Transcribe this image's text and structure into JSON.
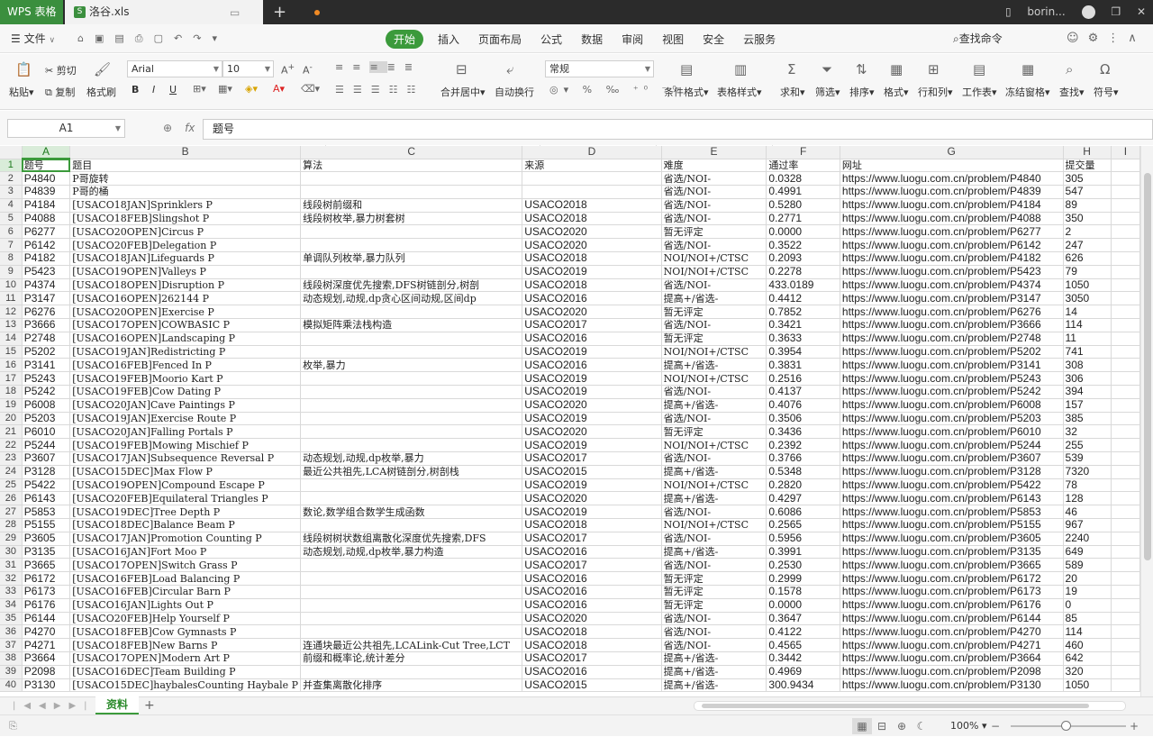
{
  "titlebar": {
    "app_tab": "WPS 表格",
    "file_tab": "洛谷.xls",
    "file_icon": "S",
    "user": "borin..."
  },
  "menubar": {
    "file_menu": "文件",
    "tabs": [
      "开始",
      "插入",
      "页面布局",
      "公式",
      "数据",
      "审阅",
      "视图",
      "安全",
      "云服务"
    ],
    "active_tab": "开始",
    "search_command": "查找命令"
  },
  "ribbon": {
    "paste": "粘贴",
    "cut": "剪切",
    "copy": "复制",
    "format_painter": "格式刷",
    "font_name": "Arial",
    "font_size": "10",
    "merge_center": "合并居中",
    "wrap_text": "自动换行",
    "number_format": "常规",
    "conditional_format": "条件格式",
    "table_style": "表格样式",
    "sum": "求和",
    "filter": "筛选",
    "sort": "排序",
    "format": "格式",
    "rows_cols": "行和列",
    "worksheet": "工作表",
    "freeze_panes": "冻结窗格",
    "find": "查找",
    "symbol": "符号"
  },
  "formula_bar": {
    "cell_ref": "A1",
    "fx": "fx",
    "content": "题号"
  },
  "sheet": {
    "column_letters": [
      "A",
      "B",
      "C",
      "D",
      "E",
      "F",
      "G",
      "H",
      "I"
    ],
    "header": [
      "题号",
      "题目",
      "算法",
      "来源",
      "难度",
      "通过率",
      "网址",
      "提交量"
    ],
    "rows": [
      [
        "P4840",
        "P哥旋转",
        "",
        "",
        "省选/NOI-",
        "0.0328",
        "https://www.luogu.com.cn/problem/P4840",
        "305"
      ],
      [
        "P4839",
        "P哥的桶",
        "",
        "",
        "省选/NOI-",
        "0.4991",
        "https://www.luogu.com.cn/problem/P4839",
        "547"
      ],
      [
        "P4184",
        "[USACO18JAN]Sprinklers P",
        "线段树前缀和",
        "USACO2018",
        "省选/NOI-",
        "0.5280",
        "https://www.luogu.com.cn/problem/P4184",
        "89"
      ],
      [
        "P4088",
        "[USACO18FEB]Slingshot P",
        "线段树枚举,暴力树套树",
        "USACO2018",
        "省选/NOI-",
        "0.2771",
        "https://www.luogu.com.cn/problem/P4088",
        "350"
      ],
      [
        "P6277",
        "[USACO20OPEN]Circus P",
        "",
        "USACO2020",
        "暂无评定",
        "0.0000",
        "https://www.luogu.com.cn/problem/P6277",
        "2"
      ],
      [
        "P6142",
        "[USACO20FEB]Delegation P",
        "",
        "USACO2020",
        "省选/NOI-",
        "0.3522",
        "https://www.luogu.com.cn/problem/P6142",
        "247"
      ],
      [
        "P4182",
        "[USACO18JAN]Lifeguards P",
        "单调队列枚举,暴力队列",
        "USACO2018",
        "NOI/NOI+/CTSC",
        "0.2093",
        "https://www.luogu.com.cn/problem/P4182",
        "626"
      ],
      [
        "P5423",
        "[USACO19OPEN]Valleys P",
        "",
        "USACO2019",
        "NOI/NOI+/CTSC",
        "0.2278",
        "https://www.luogu.com.cn/problem/P5423",
        "79"
      ],
      [
        "P4374",
        "[USACO18OPEN]Disruption P",
        "线段树深度优先搜索,DFS树链剖分,树剖",
        "USACO2018",
        "省选/NOI-",
        "433.0189",
        "https://www.luogu.com.cn/problem/P4374",
        "1050"
      ],
      [
        "P3147",
        "[USACO16OPEN]262144 P",
        "动态规划,动规,dp贪心区间动规,区间dp",
        "USACO2016",
        "提高+/省选-",
        "0.4412",
        "https://www.luogu.com.cn/problem/P3147",
        "3050"
      ],
      [
        "P6276",
        "[USACO20OPEN]Exercise P",
        "",
        "USACO2020",
        "暂无评定",
        "0.7852",
        "https://www.luogu.com.cn/problem/P6276",
        "14"
      ],
      [
        "P3666",
        "[USACO17OPEN]COWBASIC P",
        "模拟矩阵乘法栈构造",
        "USACO2017",
        "省选/NOI-",
        "0.3421",
        "https://www.luogu.com.cn/problem/P3666",
        "114"
      ],
      [
        "P2748",
        "[USACO16OPEN]Landscaping P",
        "",
        "USACO2016",
        "暂无评定",
        "0.3633",
        "https://www.luogu.com.cn/problem/P2748",
        "11"
      ],
      [
        "P5202",
        "[USACO19JAN]Redistricting P",
        "",
        "USACO2019",
        "NOI/NOI+/CTSC",
        "0.3954",
        "https://www.luogu.com.cn/problem/P5202",
        "741"
      ],
      [
        "P3141",
        "[USACO16FEB]Fenced In P",
        "枚举,暴力",
        "USACO2016",
        "提高+/省选-",
        "0.3831",
        "https://www.luogu.com.cn/problem/P3141",
        "308"
      ],
      [
        "P5243",
        "[USACO19FEB]Moorio Kart P",
        "",
        "USACO2019",
        "NOI/NOI+/CTSC",
        "0.2516",
        "https://www.luogu.com.cn/problem/P5243",
        "306"
      ],
      [
        "P5242",
        "[USACO19FEB]Cow Dating P",
        "",
        "USACO2019",
        "省选/NOI-",
        "0.4137",
        "https://www.luogu.com.cn/problem/P5242",
        "394"
      ],
      [
        "P6008",
        "[USACO20JAN]Cave Paintings P",
        "",
        "USACO2020",
        "提高+/省选-",
        "0.4076",
        "https://www.luogu.com.cn/problem/P6008",
        "157"
      ],
      [
        "P5203",
        "[USACO19JAN]Exercise Route P",
        "",
        "USACO2019",
        "省选/NOI-",
        "0.3506",
        "https://www.luogu.com.cn/problem/P5203",
        "385"
      ],
      [
        "P6010",
        "[USACO20JAN]Falling Portals P",
        "",
        "USACO2020",
        "暂无评定",
        "0.3436",
        "https://www.luogu.com.cn/problem/P6010",
        "32"
      ],
      [
        "P5244",
        "[USACO19FEB]Mowing Mischief P",
        "",
        "USACO2019",
        "NOI/NOI+/CTSC",
        "0.2392",
        "https://www.luogu.com.cn/problem/P5244",
        "255"
      ],
      [
        "P3607",
        "[USACO17JAN]Subsequence Reversal P",
        "动态规划,动规,dp枚举,暴力",
        "USACO2017",
        "省选/NOI-",
        "0.3766",
        "https://www.luogu.com.cn/problem/P3607",
        "539"
      ],
      [
        "P3128",
        "[USACO15DEC]Max Flow P",
        "最近公共祖先,LCA树链剖分,树剖栈",
        "USACO2015",
        "提高+/省选-",
        "0.5348",
        "https://www.luogu.com.cn/problem/P3128",
        "7320"
      ],
      [
        "P5422",
        "[USACO19OPEN]Compound Escape P",
        "",
        "USACO2019",
        "NOI/NOI+/CTSC",
        "0.2820",
        "https://www.luogu.com.cn/problem/P5422",
        "78"
      ],
      [
        "P6143",
        "[USACO20FEB]Equilateral Triangles P",
        "",
        "USACO2020",
        "提高+/省选-",
        "0.4297",
        "https://www.luogu.com.cn/problem/P6143",
        "128"
      ],
      [
        "P5853",
        "[USACO19DEC]Tree Depth P",
        "数论,数学组合数学生成函数",
        "USACO2019",
        "省选/NOI-",
        "0.6086",
        "https://www.luogu.com.cn/problem/P5853",
        "46"
      ],
      [
        "P5155",
        "[USACO18DEC]Balance Beam P",
        "",
        "USACO2018",
        "NOI/NOI+/CTSC",
        "0.2565",
        "https://www.luogu.com.cn/problem/P5155",
        "967"
      ],
      [
        "P3605",
        "[USACO17JAN]Promotion Counting P",
        "线段树树状数组离散化深度优先搜索,DFS",
        "USACO2017",
        "省选/NOI-",
        "0.5956",
        "https://www.luogu.com.cn/problem/P3605",
        "2240"
      ],
      [
        "P3135",
        "[USACO16JAN]Fort Moo P",
        "动态规划,动规,dp枚举,暴力构造",
        "USACO2016",
        "提高+/省选-",
        "0.3991",
        "https://www.luogu.com.cn/problem/P3135",
        "649"
      ],
      [
        "P3665",
        "[USACO17OPEN]Switch Grass P",
        "",
        "USACO2017",
        "省选/NOI-",
        "0.2530",
        "https://www.luogu.com.cn/problem/P3665",
        "589"
      ],
      [
        "P6172",
        "[USACO16FEB]Load Balancing P",
        "",
        "USACO2016",
        "暂无评定",
        "0.2999",
        "https://www.luogu.com.cn/problem/P6172",
        "20"
      ],
      [
        "P6173",
        "[USACO16FEB]Circular Barn P",
        "",
        "USACO2016",
        "暂无评定",
        "0.1578",
        "https://www.luogu.com.cn/problem/P6173",
        "19"
      ],
      [
        "P6176",
        "[USACO16JAN]Lights Out P",
        "",
        "USACO2016",
        "暂无评定",
        "0.0000",
        "https://www.luogu.com.cn/problem/P6176",
        "0"
      ],
      [
        "P6144",
        "[USACO20FEB]Help Yourself P",
        "",
        "USACO2020",
        "省选/NOI-",
        "0.3647",
        "https://www.luogu.com.cn/problem/P6144",
        "85"
      ],
      [
        "P4270",
        "[USACO18FEB]Cow Gymnasts P",
        "",
        "USACO2018",
        "省选/NOI-",
        "0.4122",
        "https://www.luogu.com.cn/problem/P4270",
        "114"
      ],
      [
        "P4271",
        "[USACO18FEB]New Barns P",
        "连通块最近公共祖先,LCALink-Cut Tree,LCT",
        "USACO2018",
        "省选/NOI-",
        "0.4565",
        "https://www.luogu.com.cn/problem/P4271",
        "460"
      ],
      [
        "P3664",
        "[USACO17OPEN]Modern Art P",
        "前缀和概率论,统计差分",
        "USACO2017",
        "提高+/省选-",
        "0.3442",
        "https://www.luogu.com.cn/problem/P3664",
        "642"
      ],
      [
        "P2098",
        "[USACO16DEC]Team Building P",
        "",
        "USACO2016",
        "提高+/省选-",
        "0.4969",
        "https://www.luogu.com.cn/problem/P2098",
        "320"
      ],
      [
        "P3130",
        "[USACO15DEC]haybalesCounting Haybale P",
        "并查集离散化排序",
        "USACO2015",
        "提高+/省选-",
        "300.9434",
        "https://www.luogu.com.cn/problem/P3130",
        "1050"
      ]
    ]
  },
  "sheet_tabs": {
    "active": "资料"
  },
  "status": {
    "zoom": "100%"
  }
}
